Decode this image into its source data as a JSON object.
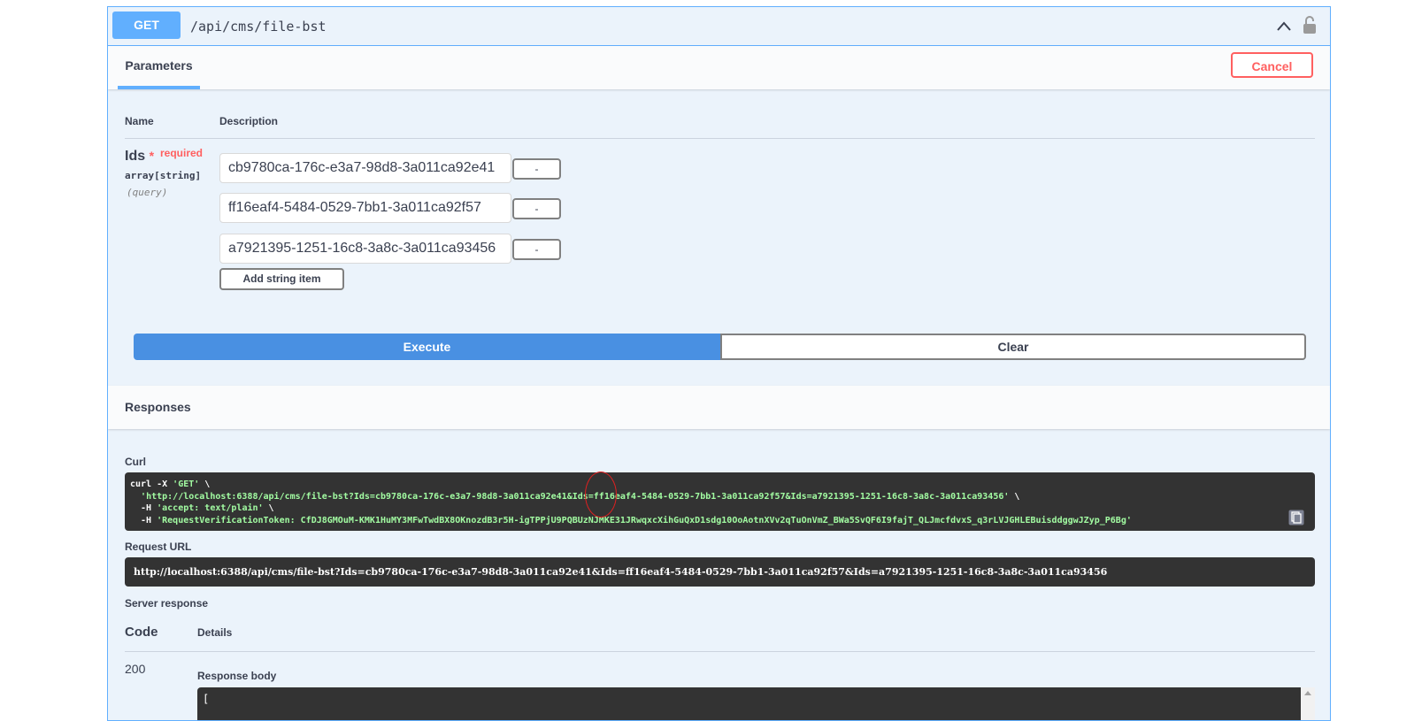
{
  "operation": {
    "method": "GET",
    "path": "/api/cms/file-bst"
  },
  "parameters": {
    "tab_label": "Parameters",
    "cancel_label": "Cancel",
    "col_name": "Name",
    "col_description": "Description",
    "param": {
      "name": "Ids",
      "required_star": "*",
      "required_label": "required",
      "type": "array[string]",
      "location": "(query)",
      "items": [
        "cb9780ca-176c-e3a7-98d8-3a011ca92e41",
        "ff16eaf4-5484-0529-7bb1-3a011ca92f57",
        "a7921395-1251-16c8-3a8c-3a011ca93456"
      ],
      "remove_label": "-",
      "add_item_label": "Add string item"
    }
  },
  "actions": {
    "execute_label": "Execute",
    "clear_label": "Clear"
  },
  "responses": {
    "title": "Responses",
    "curl_label": "Curl",
    "curl": {
      "l1_a": "curl -X ",
      "l1_b": "'GET'",
      "l1_c": " \\",
      "l2_a": "  ",
      "l2_b": "'http://localhost:6388/api/cms/file-bst?Ids=cb9780ca-176c-e3a7-98d8-3a011ca92e41&Ids=ff16eaf4-5484-0529-7bb1-3a011ca92f57&Ids=a7921395-1251-16c8-3a8c-3a011ca93456'",
      "l2_c": " \\",
      "l3_a": "  -H ",
      "l3_b": "'accept: text/plain'",
      "l3_c": " \\",
      "l4_a": "  -H ",
      "l4_b": "'RequestVerificationToken: CfDJ8GMOuM-KMK1HuMY3MFwTwdBX8OKnozdB3r5H-igTPPjU9PQBUzNJMKE31JRwqxcXihGuQxD1sdg10OoAotnXVv2qTuOnVmZ_BWa5SvQF6I9fajT_QLJmcfdvxS_q3rLVJGHLEBuisddggwJZyp_P6Bg'"
    },
    "request_url_label": "Request URL",
    "request_url": "http://localhost:6388/api/cms/file-bst?Ids=cb9780ca-176c-e3a7-98d8-3a011ca92e41&Ids=ff16eaf4-5484-0529-7bb1-3a011ca92f57&Ids=a7921395-1251-16c8-3a8c-3a011ca93456",
    "server_response_label": "Server response",
    "code_header": "Code",
    "details_header": "Details",
    "status_code": "200",
    "response_body_label": "Response body",
    "response_body_start": "["
  },
  "colors": {
    "get_blue": "#61affe",
    "execute_blue": "#4990e2",
    "cancel_red": "#ff6060",
    "code_bg": "#333333",
    "string_green": "#a2fca2"
  },
  "icons": [
    "chevron-up-icon",
    "lock-icon",
    "copy-to-clipboard-icon"
  ]
}
